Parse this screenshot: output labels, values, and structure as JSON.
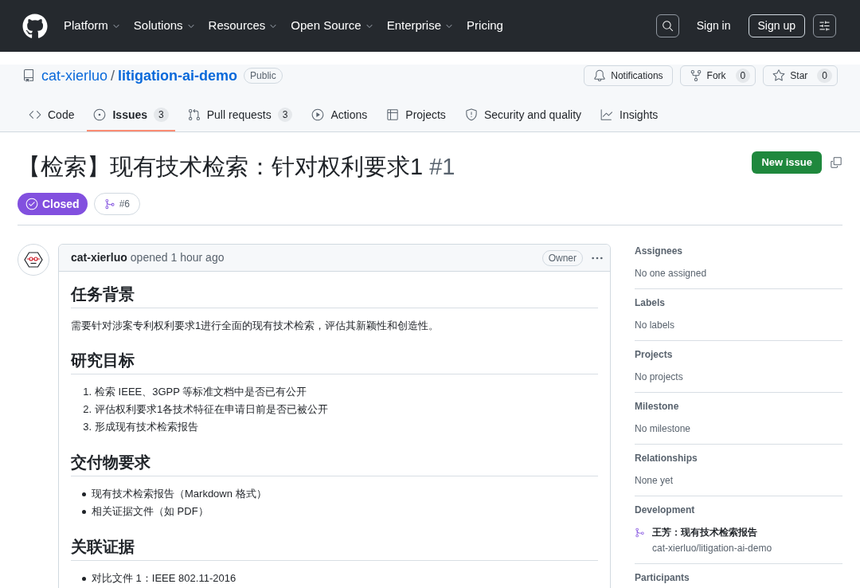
{
  "header": {
    "nav": [
      {
        "label": "Platform",
        "dropdown": true
      },
      {
        "label": "Solutions",
        "dropdown": true
      },
      {
        "label": "Resources",
        "dropdown": true
      },
      {
        "label": "Open Source",
        "dropdown": true
      },
      {
        "label": "Enterprise",
        "dropdown": true
      },
      {
        "label": "Pricing",
        "dropdown": false
      }
    ],
    "sign_in": "Sign in",
    "sign_up": "Sign up"
  },
  "repo": {
    "owner": "cat-xierluo",
    "separator": "/",
    "name": "litigation-ai-demo",
    "visibility": "Public",
    "actions": [
      {
        "kind": "notifications",
        "label": "Notifications"
      },
      {
        "kind": "fork",
        "label": "Fork",
        "count": "0"
      },
      {
        "kind": "star",
        "label": "Star",
        "count": "0"
      }
    ]
  },
  "tabs": [
    {
      "kind": "code",
      "label": "Code",
      "selected": false
    },
    {
      "kind": "issues",
      "label": "Issues",
      "count": "3",
      "selected": true
    },
    {
      "kind": "pulls",
      "label": "Pull requests",
      "count": "3",
      "selected": false
    },
    {
      "kind": "actions",
      "label": "Actions",
      "selected": false
    },
    {
      "kind": "projects",
      "label": "Projects",
      "selected": false
    },
    {
      "kind": "security",
      "label": "Security and quality",
      "selected": false
    },
    {
      "kind": "insights",
      "label": "Insights",
      "selected": false
    }
  ],
  "issue": {
    "title": "【检索】现有技术检索：针对权利要求1",
    "number": "#1",
    "new_issue_button": "New issue",
    "status": {
      "closed": true,
      "label": "Closed"
    },
    "linked_pull_request": "#6"
  },
  "comment": {
    "author": "cat-xierluo",
    "action": "opened",
    "time": "1 hour ago",
    "role": "Owner",
    "body": [
      {
        "kind": "heading",
        "text": "任务背景"
      },
      {
        "kind": "paragraph",
        "text": "需要针对涉案专利权利要求1进行全面的现有技术检索，评估其新颖性和创造性。"
      },
      {
        "kind": "heading",
        "text": "研究目标"
      },
      {
        "kind": "ordered_list",
        "items": [
          {
            "marker": "1.",
            "text": "检索 IEEE、3GPP 等标准文档中是否已有公开"
          },
          {
            "marker": "2.",
            "text": "评估权利要求1各技术特征在申请日前是否已被公开"
          },
          {
            "marker": "3.",
            "text": "形成现有技术检索报告"
          }
        ]
      },
      {
        "kind": "heading",
        "text": "交付物要求"
      },
      {
        "kind": "bullet_list",
        "items": [
          "现有技术检索报告（Markdown 格式）",
          "相关证据文件（如 PDF）"
        ]
      },
      {
        "kind": "heading",
        "text": "关联证据"
      },
      {
        "kind": "bullet_list",
        "items": [
          "对比文件 1：IEEE 802.11-2016"
        ]
      }
    ]
  },
  "sidebar": [
    {
      "kind": "text",
      "label": "Assignees",
      "value": "No one assigned"
    },
    {
      "kind": "text",
      "label": "Labels",
      "value": "No labels"
    },
    {
      "kind": "text",
      "label": "Projects",
      "value": "No projects"
    },
    {
      "kind": "text",
      "label": "Milestone",
      "value": "No milestone"
    },
    {
      "kind": "text",
      "label": "Relationships",
      "value": "None yet"
    },
    {
      "kind": "links",
      "label": "Development",
      "links": [
        {
          "title": "王芳：现有技术检索报告",
          "repo": "cat-xierluo/litigation-ai-demo"
        }
      ]
    },
    {
      "kind": "label",
      "label": "Participants"
    }
  ]
}
